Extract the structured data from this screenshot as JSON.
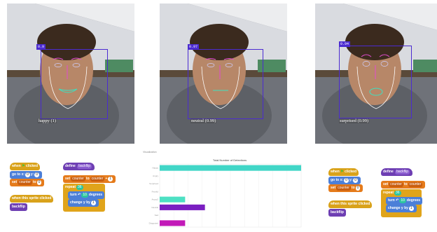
{
  "panels": [
    {
      "score": "0.9",
      "label": "happy (1)"
    },
    {
      "score": "0.97",
      "label": "neutral (0.99)"
    },
    {
      "score": "0.94",
      "label": "surprised (0.99)"
    }
  ],
  "scratch": {
    "when_flag": "when",
    "clicked": "clicked",
    "go_to": "go to x:",
    "x_val": "0",
    "y_label": "y:",
    "y_val": "0",
    "set": "set",
    "counter": "counter",
    "to": "to",
    "set_val": "0",
    "when_sprite": "when this sprite clicked",
    "backflip": "backflip",
    "define": "define",
    "change": "change",
    "by": "by",
    "change_val": "1",
    "repeat": "repeat",
    "repeat_val": "36",
    "turn": "turn",
    "degrees": "degrees",
    "turn_val": "10",
    "y_by": "change y by",
    "y_by_val": "1"
  },
  "chart_data": {
    "type": "bar",
    "orientation": "horizontal",
    "title": "Total Number of Detections",
    "top_label": "Visualization",
    "categories": [
      "Happy",
      "Angry",
      "Surprised",
      "Fearful",
      "Angry2",
      "Neutral",
      "Sad",
      "Disgusted"
    ],
    "values": [
      100,
      0,
      0,
      0,
      18,
      32,
      0,
      18
    ],
    "colors": [
      "#41d6c7",
      "#41d6c7",
      "#41d6c7",
      "#41d6c7",
      "#4de0c3",
      "#7a1fc1",
      "#7a1fc1",
      "#c21ab8"
    ],
    "xlim": [
      0,
      100
    ],
    "grid": true
  }
}
